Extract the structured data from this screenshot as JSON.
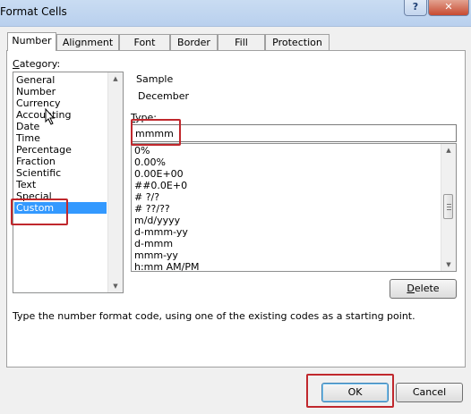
{
  "window": {
    "title": "Format Cells",
    "help_button": "?",
    "close_button": "✕"
  },
  "tabs": [
    {
      "label": "Number"
    },
    {
      "label": "Alignment"
    },
    {
      "label": "Font"
    },
    {
      "label": "Border"
    },
    {
      "label": "Fill"
    },
    {
      "label": "Protection"
    }
  ],
  "category": {
    "label_first": "C",
    "label_rest": "ategory:",
    "items": [
      {
        "label": "General"
      },
      {
        "label": "Number"
      },
      {
        "label": "Currency"
      },
      {
        "label": "Accounting"
      },
      {
        "label": "Date"
      },
      {
        "label": "Time"
      },
      {
        "label": "Percentage"
      },
      {
        "label": "Fraction"
      },
      {
        "label": "Scientific"
      },
      {
        "label": "Text"
      },
      {
        "label": "Special"
      },
      {
        "label": "Custom"
      }
    ],
    "selected": "Custom"
  },
  "sample": {
    "label": "Sample",
    "value": "December"
  },
  "type": {
    "label_first": "T",
    "label_rest": "ype:",
    "value": "mmmm",
    "items": [
      {
        "label": "0%"
      },
      {
        "label": "0.00%"
      },
      {
        "label": "0.00E+00"
      },
      {
        "label": "##0.0E+0"
      },
      {
        "label": "# ?/?"
      },
      {
        "label": "# ??/??"
      },
      {
        "label": "m/d/yyyy"
      },
      {
        "label": "d-mmm-yy"
      },
      {
        "label": "d-mmm"
      },
      {
        "label": "mmm-yy"
      },
      {
        "label": "h:mm AM/PM"
      }
    ]
  },
  "delete_button": {
    "first": "D",
    "rest": "elete"
  },
  "hint": "Type the number format code, using one of the existing codes as a starting point.",
  "footer": {
    "ok_label": "OK",
    "cancel_label": "Cancel"
  },
  "colors": {
    "selection": "#3399ff",
    "highlight": "#c0282d",
    "title_bar": "#c9dcf2",
    "close_button": "#c74a31"
  }
}
